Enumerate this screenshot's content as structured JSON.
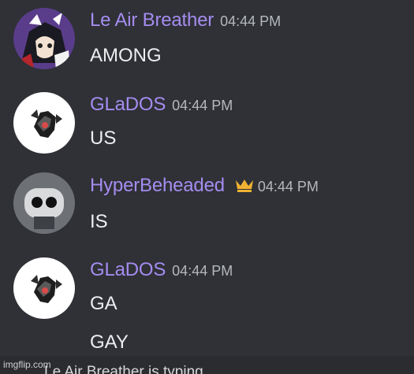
{
  "messages": [
    {
      "author": "Le Air Breather",
      "timestamp": "04:44 PM",
      "lines": [
        "AMONG"
      ],
      "avatar_icon": "anime-character-avatar",
      "has_crown": false
    },
    {
      "author": "GLaDOS",
      "timestamp": "04:44 PM",
      "lines": [
        "US"
      ],
      "avatar_icon": "glados-robot-avatar",
      "has_crown": false
    },
    {
      "author": "HyperBeheaded",
      "timestamp": "04:44 PM",
      "lines": [
        "IS"
      ],
      "avatar_icon": "black-mask-avatar",
      "has_crown": true
    },
    {
      "author": "GLaDOS",
      "timestamp": "04:44 PM",
      "lines": [
        "GA",
        "GAY"
      ],
      "avatar_icon": "glados-robot-avatar",
      "has_crown": false
    }
  ],
  "typing_indicator": "Le Air Breather is typing...",
  "watermark": "imgflip.com",
  "colors": {
    "background": "#2f3136",
    "username": "#a58cf0",
    "timestamp": "#b5b8bd",
    "message_text": "#eceef0",
    "crown": "#f0b232"
  }
}
